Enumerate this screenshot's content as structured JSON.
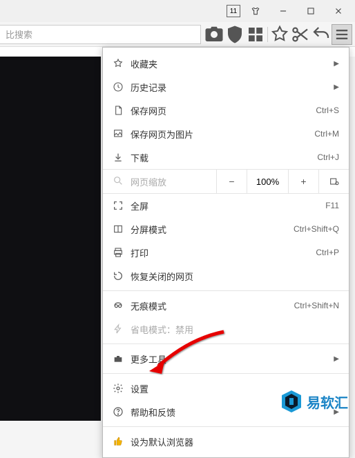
{
  "titlebar": {
    "tab_count": "11"
  },
  "toolbar": {
    "search_placeholder": "比搜索"
  },
  "menu": {
    "bookmarks": "收藏夹",
    "history": "历史记录",
    "save_page": "保存网页",
    "save_page_shortcut": "Ctrl+S",
    "save_as_image": "保存网页为图片",
    "save_as_image_shortcut": "Ctrl+M",
    "downloads": "下载",
    "downloads_shortcut": "Ctrl+J",
    "zoom_label": "网页缩放",
    "zoom_value": "100%",
    "fullscreen": "全屏",
    "fullscreen_shortcut": "F11",
    "split": "分屏模式",
    "split_shortcut": "Ctrl+Shift+Q",
    "print": "打印",
    "print_shortcut": "Ctrl+P",
    "reopen": "恢复关闭的网页",
    "incognito": "无痕模式",
    "incognito_shortcut": "Ctrl+Shift+N",
    "powersave": "省电模式：禁用",
    "moretools": "更多工具",
    "settings": "设置",
    "help": "帮助和反馈",
    "setdefault": "设为默认浏览器"
  },
  "watermark": {
    "text": "易软汇"
  }
}
